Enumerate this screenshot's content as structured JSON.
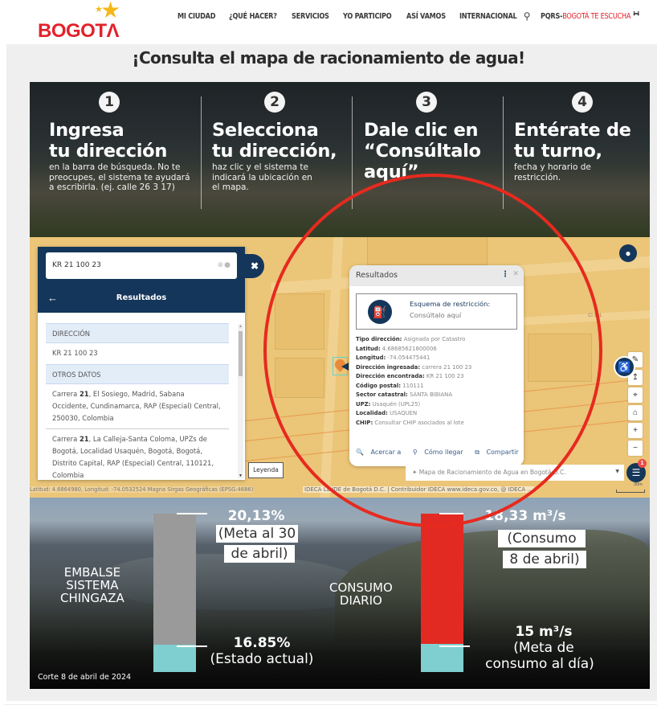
{
  "header": {
    "logo_text": "BOGOTΛ",
    "nav": [
      "MI CIUDAD",
      "¿QUÉ HACER?",
      "SERVICIOS",
      "YO PARTICIPO",
      "ASÍ VAMOS",
      "INTERNACIONAL"
    ],
    "search_icon": "search-icon",
    "pqrs_prefix": "PQRS-",
    "pqrs_suffix": "BOGOTÁ TE ESCUCHA",
    "rss_icon": "rss-icon"
  },
  "page_title": "¡Consulta el mapa de racionamiento de agua!",
  "steps": [
    {
      "num": "1",
      "title": "Ingresa\ntu dirección",
      "desc": "en la barra de búsqueda. No te\npreocupes, el sistema te ayudará\na escribirla. (ej. calle 26 3 17)"
    },
    {
      "num": "2",
      "title": "Selecciona\ntu dirección,",
      "desc": "haz clic y el sistema te\nindicará la ubicación en\nel mapa."
    },
    {
      "num": "3",
      "title": "Dale clic en\n“Consúltalo\naquí”",
      "desc": ""
    },
    {
      "num": "4",
      "title": "Entérate de\ntu turno,",
      "desc": "fecha y horario de\nrestricción."
    }
  ],
  "map": {
    "search_value": "KR 21 100 23",
    "results_title": "Resultados",
    "direccion_header": "DIRECCIÓN",
    "direccion_value": "KR 21 100 23",
    "otros_header": "OTROS DATOS",
    "addresses": [
      {
        "bold": "21",
        "before": "Carrera ",
        "after": ", El Sosiego, Madrid, Sabana Occidente, Cundinamarca, RAP (Especial) Central, 250030, Colombia"
      },
      {
        "bold": "21",
        "before": "Carrera ",
        "after": ", La Calleja-Santa Coloma, UPZs de Bogotá, Localidad Usaquén, Bogotá, Bogotá, Distrito Capital, RAP (Especial) Central, 110121, Colombia"
      }
    ],
    "legend_label": "Leyenda",
    "coords": "Latitud: 4.6864980, Longitud: -74.0532524 Magna Sirgas Geográficas (EPSG:4686)",
    "street_label": "Cl 101",
    "popup": {
      "title": "Resultados",
      "restriction_title": "Esquema de restricción:",
      "restriction_link": "Consúltalo aquí",
      "fields": [
        {
          "label": "Tipo dirección:",
          "value": "Asignada por Catastro"
        },
        {
          "label": "Latitud:",
          "value": "4.68685621800006"
        },
        {
          "label": "Longitud:",
          "value": "-74.054475441"
        },
        {
          "label": "Dirección ingresada:",
          "value": "carrera 21 100 23"
        },
        {
          "label": "Dirección encontrada:",
          "value": "KR 21 100 23"
        },
        {
          "label": "Código postal:",
          "value": "110111"
        },
        {
          "label": "Sector catastral:",
          "value": "SANTA BIBIANA"
        },
        {
          "label": "UPZ:",
          "value": "Usaquén (UPL25)"
        },
        {
          "label": "Localidad:",
          "value": "USAQUEN"
        },
        {
          "label": "CHIP:",
          "value": "Consultar CHIP asociados al lote"
        }
      ],
      "actions": [
        "Acercar a",
        "Cómo llegar",
        "Compartir"
      ]
    },
    "layer_select": "Mapa de Racionamiento de Agua en Bogotá D.C.",
    "layers_badge": "1",
    "attribution": "IDECA La IDE de Bogotá D.C. | Contribuidor IDECA www.ideca.gov.co, @ IDECA ...",
    "scale": "30m"
  },
  "infographic": {
    "left_title": "EMBALSE\nSISTEMA\nCHINGAZA",
    "left_top_value": "20,13%",
    "left_top_note_1": "(Meta al 30",
    "left_top_note_2": "de abril)",
    "left_bottom_value": "16.85%",
    "left_bottom_note": "(Estado actual)",
    "right_title": "CONSUMO\nDIARIO",
    "right_top_value": "18,33 m³/s",
    "right_top_note_1": "(Consumo",
    "right_top_note_2": "8 de abril)",
    "right_bottom_value": "15 m³/s",
    "right_bottom_note_1": "(Meta de",
    "right_bottom_note_2": "consumo al día)",
    "cut_note": "Corte 8 de abril de 2024",
    "colors": {
      "grey_bar": "#9a9a9a",
      "red_bar": "#e32a22",
      "water": "#7fcfd0"
    }
  }
}
